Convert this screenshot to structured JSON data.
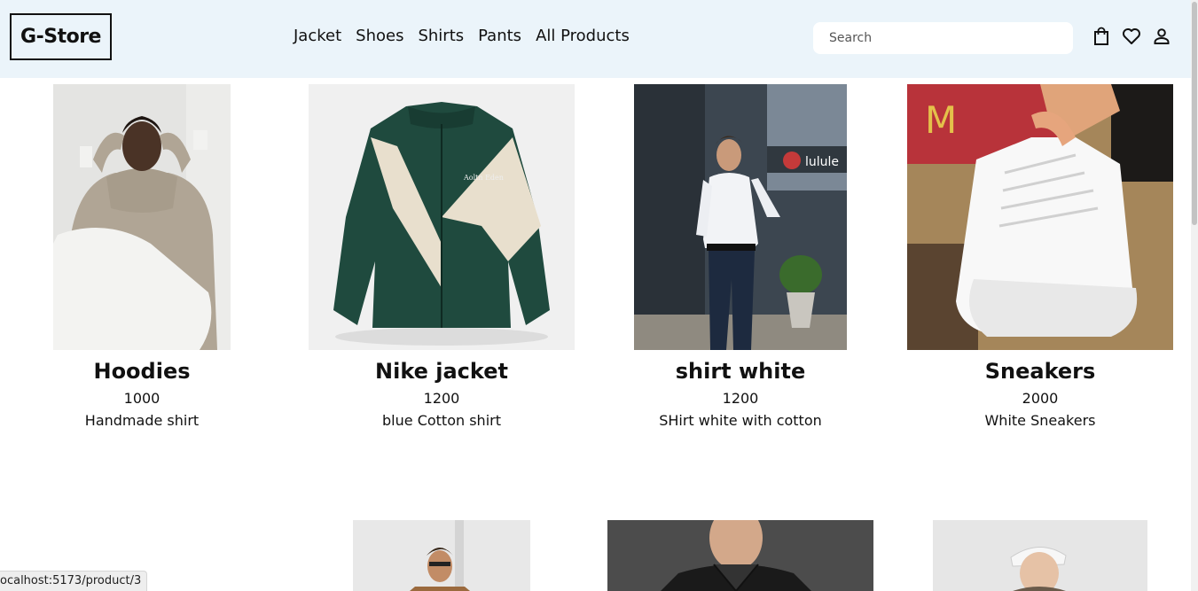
{
  "header": {
    "logo": "G-Store",
    "nav": [
      "Jacket",
      "Shoes",
      "Shirts",
      "Pants",
      "All Products"
    ],
    "search_placeholder": "Search",
    "icons": [
      "shopping-bag-icon",
      "heart-icon",
      "user-icon"
    ]
  },
  "products": [
    {
      "title": "Hoodies",
      "price": "1000",
      "desc": "Handmade shirt"
    },
    {
      "title": "Nike jacket",
      "price": "1200",
      "desc": "blue Cotton shirt"
    },
    {
      "title": "shirt white",
      "price": "1200",
      "desc": "SHirt white with cotton"
    },
    {
      "title": "Sneakers",
      "price": "2000",
      "desc": "White Sneakers"
    }
  ],
  "status_bar": {
    "url": "ocalhost:5173/product/3"
  },
  "colors": {
    "header_bg": "#ebf4fa",
    "jacket_green": "#1f4a3e",
    "jacket_cream": "#e8dfcd"
  }
}
